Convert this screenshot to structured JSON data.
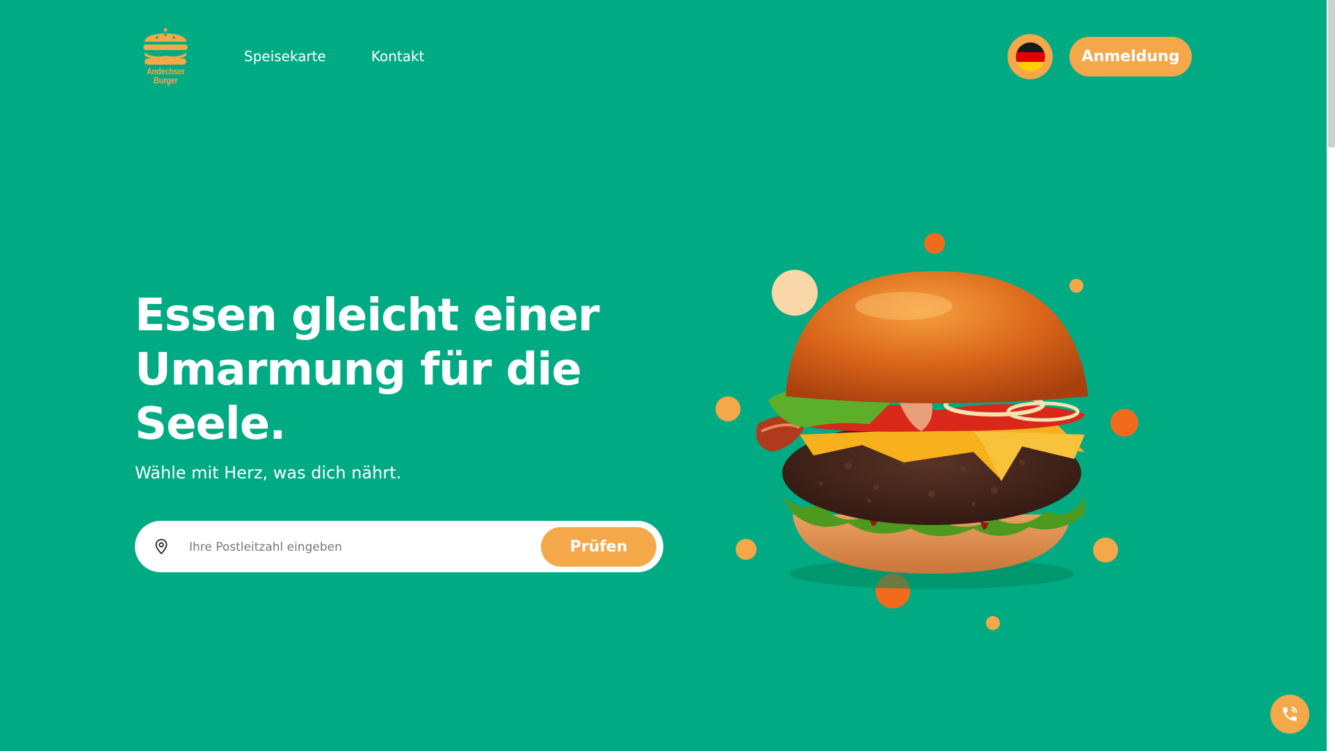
{
  "brand": {
    "name_line1": "Andechser",
    "name_line2": "Burger",
    "color_primary": "#00AB84",
    "color_accent": "#F5A84A"
  },
  "nav": {
    "items": [
      {
        "label": "Speisekarte"
      },
      {
        "label": "Kontakt"
      }
    ]
  },
  "header": {
    "language_icon": "german-flag-icon",
    "login_label": "Anmeldung"
  },
  "hero": {
    "title": "Essen gleicht einer Umarmung für die Seele.",
    "subtitle": "Wähle mit Herz, was dich nährt.",
    "zip_placeholder": "Ihre Postleitzahl eingeben",
    "zip_value": "",
    "check_label": "Prüfen",
    "image_subject": "burger-illustration"
  },
  "floating": {
    "call_icon": "phone-icon"
  }
}
